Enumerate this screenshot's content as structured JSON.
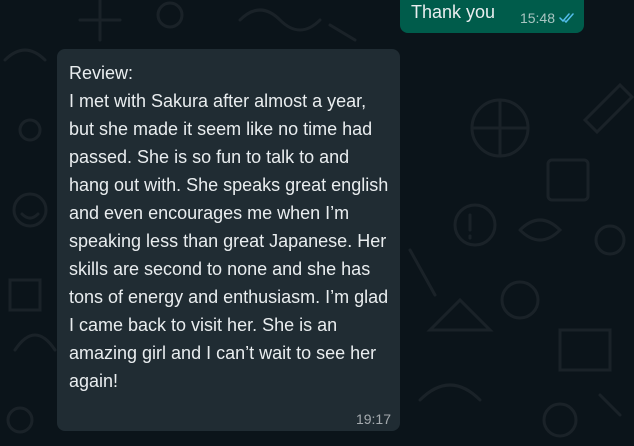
{
  "colors": {
    "background": "#0b141a",
    "outgoing_bubble": "#005c4b",
    "incoming_bubble": "#202c33",
    "text": "#e9edef",
    "read_ticks": "#53bdeb"
  },
  "messages": [
    {
      "direction": "outgoing",
      "text": "Thank you",
      "time": "15:48",
      "status_icon": "double-check-read-icon"
    },
    {
      "direction": "incoming",
      "text": "Review:\nI met with Sakura after almost a year, but she made it seem like no time had passed. She is so fun to talk to and hang out with. She speaks great english and even encourages me when I’m speaking less than great Japanese. Her skills are second to none and she has tons of energy and enthusiasm. I’m glad I came back to visit her. She is an amazing girl and I can’t wait to see her again!",
      "time": "19:17"
    }
  ]
}
